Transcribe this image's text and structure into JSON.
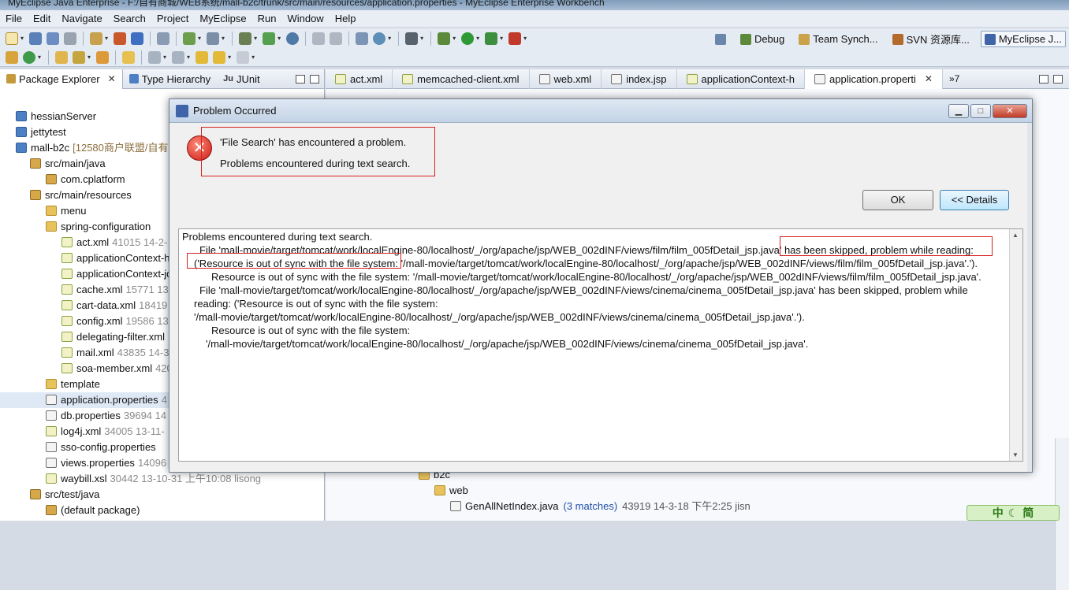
{
  "window": {
    "title": "MyEclipse Java Enterprise - F:/自有商城/WEB系统/mall-b2c/trunk/src/main/resources/application.properties - MyEclipse Enterprise Workbench"
  },
  "menu": [
    "File",
    "Edit",
    "Navigate",
    "Search",
    "Project",
    "MyEclipse",
    "Run",
    "Window",
    "Help"
  ],
  "perspectives": [
    {
      "label": "Debug",
      "icon": "debug-perspective-icon"
    },
    {
      "label": "Team Synch...",
      "icon": "team-sync-icon"
    },
    {
      "label": "SVN 资源库...",
      "icon": "svn-icon"
    },
    {
      "label": "MyEclipse J...",
      "icon": "myeclipse-icon"
    }
  ],
  "left_tabs": {
    "package_explorer": "Package Explorer",
    "type_hierarchy": "Type Hierarchy",
    "junit": "JUnit",
    "junit_prefix": "Ju"
  },
  "tree": [
    {
      "label": "hessianServer",
      "meta": "",
      "indent": 1,
      "icon": "project"
    },
    {
      "label": "jettytest",
      "meta": "",
      "indent": 1,
      "icon": "project"
    },
    {
      "label": "mall-b2c",
      "meta": "[12580商户联盟/自有商",
      "indent": 1,
      "icon": "project"
    },
    {
      "label": "src/main/java",
      "meta": "",
      "indent": 2,
      "icon": "pkg"
    },
    {
      "label": "com.cplatform",
      "meta": "",
      "indent": 3,
      "icon": "pkg"
    },
    {
      "label": "src/main/resources",
      "meta": "",
      "indent": 2,
      "icon": "pkg"
    },
    {
      "label": "menu",
      "meta": "",
      "indent": 3,
      "icon": "folder"
    },
    {
      "label": "spring-configuration",
      "meta": "",
      "indent": 3,
      "icon": "folder"
    },
    {
      "label": "act.xml",
      "meta": "41015  14-2-",
      "indent": 4,
      "icon": "xml"
    },
    {
      "label": "applicationContext-h",
      "meta": "",
      "indent": 4,
      "icon": "xml"
    },
    {
      "label": "applicationContext-jd",
      "meta": "",
      "indent": 4,
      "icon": "xml"
    },
    {
      "label": "cache.xml",
      "meta": "15771  13",
      "indent": 4,
      "icon": "xml"
    },
    {
      "label": "cart-data.xml",
      "meta": "18419",
      "indent": 4,
      "icon": "xml"
    },
    {
      "label": "config.xml",
      "meta": "19586  13",
      "indent": 4,
      "icon": "xml"
    },
    {
      "label": "delegating-filter.xml",
      "meta": "",
      "indent": 4,
      "icon": "xml"
    },
    {
      "label": "mail.xml",
      "meta": "43835  14-3",
      "indent": 4,
      "icon": "xml"
    },
    {
      "label": "soa-member.xml",
      "meta": "420",
      "indent": 4,
      "icon": "xml"
    },
    {
      "label": "template",
      "meta": "",
      "indent": 3,
      "icon": "folder"
    },
    {
      "label": "application.properties",
      "meta": "4",
      "indent": 3,
      "icon": "props",
      "selected": true
    },
    {
      "label": "db.properties",
      "meta": "39694  14",
      "indent": 3,
      "icon": "props"
    },
    {
      "label": "log4j.xml",
      "meta": "34005  13-11-",
      "indent": 3,
      "icon": "xml"
    },
    {
      "label": "sso-config.properties",
      "meta": "",
      "indent": 3,
      "icon": "props"
    },
    {
      "label": "views.properties",
      "meta": "14096",
      "indent": 3,
      "icon": "props"
    },
    {
      "label": "waybill.xsl",
      "meta": "30442  13-10-31 上午10:08  lisong",
      "indent": 3,
      "icon": "xml"
    },
    {
      "label": "src/test/java",
      "meta": "",
      "indent": 2,
      "icon": "pkg"
    },
    {
      "label": "(default package)",
      "meta": "",
      "indent": 3,
      "icon": "pkg"
    }
  ],
  "editor_tabs": [
    {
      "label": "act.xml",
      "icon": "xml"
    },
    {
      "label": "memcached-client.xml",
      "icon": "xml"
    },
    {
      "label": "web.xml",
      "icon": "xml"
    },
    {
      "label": "index.jsp",
      "icon": "jsp"
    },
    {
      "label": "applicationContext-h",
      "icon": "xml"
    },
    {
      "label": "application.properti",
      "icon": "props",
      "active": true
    }
  ],
  "editor_overflow": "»7",
  "lower": [
    {
      "label": "b2c",
      "indent": 1,
      "icon": "folder"
    },
    {
      "label": "web",
      "indent": 2,
      "icon": "folder"
    },
    {
      "label": "GenAllNetIndex.java",
      "matches": "(3 matches)",
      "meta": "43919  14-3-18 下午2:25  jisn",
      "indent": 3,
      "icon": "java"
    }
  ],
  "ime": {
    "label": "中",
    "mode": "简"
  },
  "dialog": {
    "title": "Problem Occurred",
    "message1": "'File Search' has encountered a problem.",
    "message2": "Problems encountered during text search.",
    "ok": "OK",
    "details": "<< Details",
    "lines": [
      "Problems encountered during text search.",
      "File 'mall-movie/target/tomcat/work/localEngine-80/localhost/_/org/apache/jsp/WEB_002dINF/views/film/film_005fDetail_jsp.java' has been skipped, problem while reading:",
      "('Resource is out of sync with the file system: '/mall-movie/target/tomcat/work/localEngine-80/localhost/_/org/apache/jsp/WEB_002dINF/views/film/film_005fDetail_jsp.java'.').",
      "Resource is out of sync with the file system: '/mall-movie/target/tomcat/work/localEngine-80/localhost/_/org/apache/jsp/WEB_002dINF/views/film/film_005fDetail_jsp.java'.",
      "File 'mall-movie/target/tomcat/work/localEngine-80/localhost/_/org/apache/jsp/WEB_002dINF/views/cinema/cinema_005fDetail_jsp.java' has been skipped, problem while",
      "reading: ('Resource is out of sync with the file system:",
      "'/mall-movie/target/tomcat/work/localEngine-80/localhost/_/org/apache/jsp/WEB_002dINF/views/cinema/cinema_005fDetail_jsp.java'.').",
      "Resource is out of sync with the file system:",
      "'/mall-movie/target/tomcat/work/localEngine-80/localhost/_/org/apache/jsp/WEB_002dINF/views/cinema/cinema_005fDetail_jsp.java'."
    ]
  }
}
